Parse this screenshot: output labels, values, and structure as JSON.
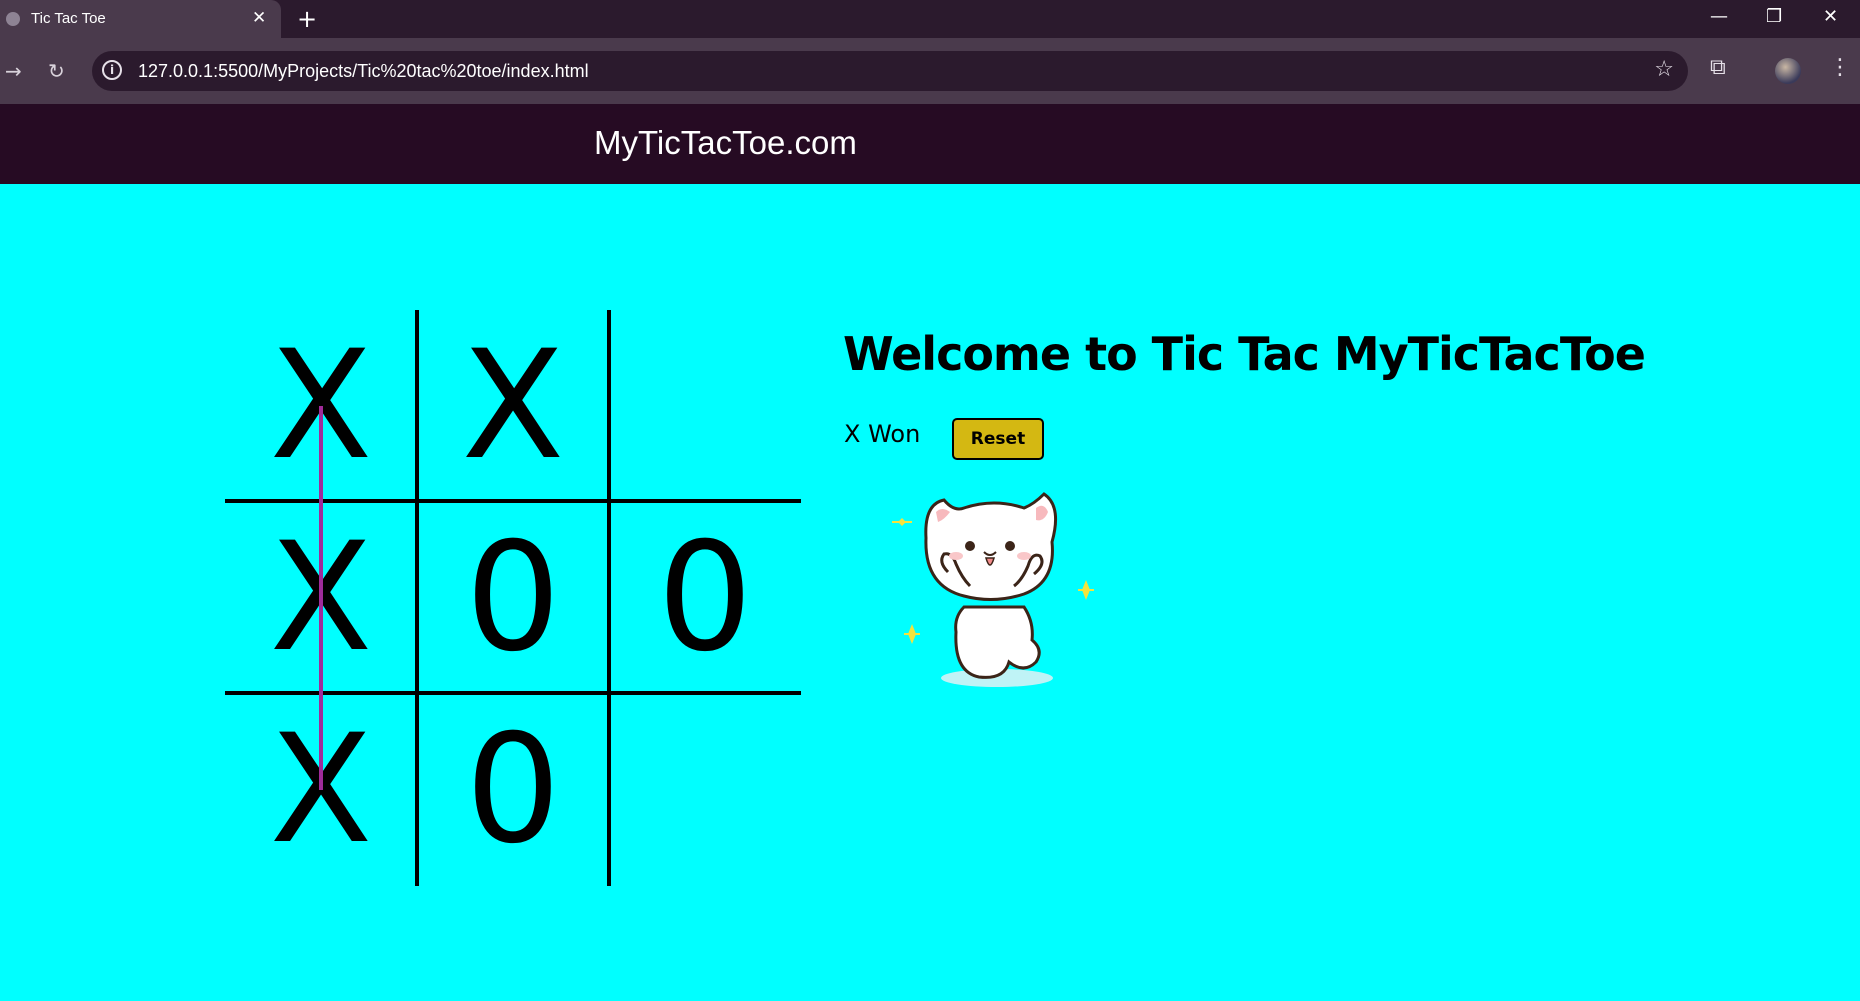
{
  "browser": {
    "tab_title": "Tic Tac Toe",
    "tab_close": "✕",
    "new_tab": "+",
    "url": "127.0.0.1:5500/MyProjects/Tic%20tac%20toe/index.html",
    "window_controls": {
      "minimize": "—",
      "restore": "❐",
      "close": "✕"
    },
    "icons": [
      "favicon-icon",
      "forward-icon",
      "reload-icon",
      "info-icon",
      "star-icon",
      "extensions-icon",
      "avatar",
      "menu-icon"
    ]
  },
  "header": {
    "title": "MyTicTacToe.com"
  },
  "main": {
    "heading": "Welcome to Tic Tac MyTicTacToe",
    "status": "X Won",
    "reset_label": "Reset",
    "board": {
      "cells": [
        "X",
        "X",
        "",
        "X",
        "0",
        "0",
        "X",
        "0",
        ""
      ],
      "winning_line": "column 1",
      "winning_line_color": "#a02b9a"
    }
  },
  "colors": {
    "page_background": "#00ffff",
    "header_background": "#260b23",
    "reset_button": "#d4b812"
  }
}
